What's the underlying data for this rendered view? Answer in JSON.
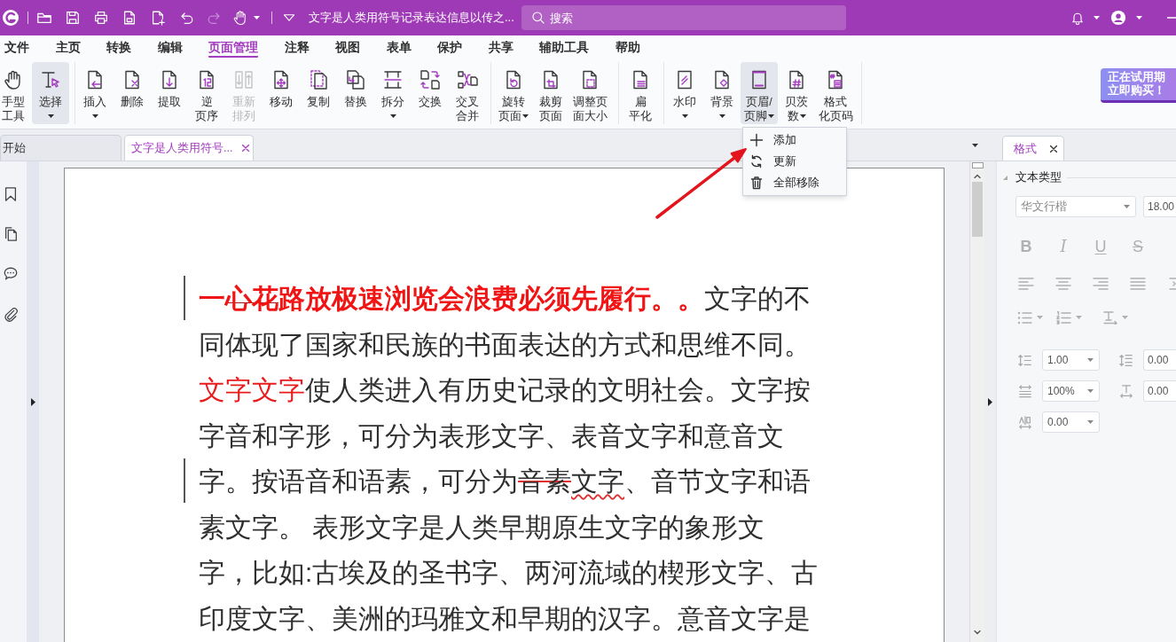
{
  "title_bar": {
    "redo": {
      "disabled": true
    },
    "document_title": "文字是人类用符号记录表达信息以传之...",
    "search": {
      "placeholder": "搜索"
    }
  },
  "menu": [
    {
      "label": "文件",
      "selected": false
    },
    {
      "label": "主页",
      "selected": false
    },
    {
      "label": "转换",
      "selected": false
    },
    {
      "label": "编辑",
      "selected": false
    },
    {
      "label": "页面管理",
      "selected": true
    },
    {
      "label": "注释",
      "selected": false
    },
    {
      "label": "视图",
      "selected": false
    },
    {
      "label": "表单",
      "selected": false
    },
    {
      "label": "保护",
      "selected": false
    },
    {
      "label": "共享",
      "selected": false
    },
    {
      "label": "辅助工具",
      "selected": false
    },
    {
      "label": "帮助",
      "selected": false
    }
  ],
  "ribbon": {
    "groups": [
      [
        {
          "kind": "hand",
          "lines": [
            "手型",
            "工具"
          ],
          "dropdown": false,
          "active": false,
          "disabled": false
        },
        {
          "kind": "select",
          "lines": [
            "选择"
          ],
          "dropdown": true,
          "active": true,
          "disabled": false
        }
      ],
      [
        {
          "kind": "insert",
          "lines": [
            "插入"
          ],
          "dropdown": true,
          "active": false,
          "disabled": false
        },
        {
          "kind": "delete",
          "lines": [
            "删除"
          ],
          "dropdown": false,
          "active": false,
          "disabled": false
        },
        {
          "kind": "extract",
          "lines": [
            "提取"
          ],
          "dropdown": false,
          "active": false,
          "disabled": false
        },
        {
          "kind": "reverse",
          "lines": [
            "逆",
            "页序"
          ],
          "dropdown": false,
          "active": false,
          "disabled": false
        },
        {
          "kind": "reorder",
          "lines": [
            "重新",
            "排列"
          ],
          "dropdown": false,
          "active": false,
          "disabled": true
        },
        {
          "kind": "move",
          "lines": [
            "移动"
          ],
          "dropdown": false,
          "active": false,
          "disabled": false
        },
        {
          "kind": "copy",
          "lines": [
            "复制"
          ],
          "dropdown": false,
          "active": false,
          "disabled": false
        },
        {
          "kind": "replace",
          "lines": [
            "替换"
          ],
          "dropdown": false,
          "active": false,
          "disabled": false
        },
        {
          "kind": "split",
          "lines": [
            "拆分"
          ],
          "dropdown": true,
          "active": false,
          "disabled": false
        },
        {
          "kind": "swap",
          "lines": [
            "交换"
          ],
          "dropdown": false,
          "active": false,
          "disabled": false
        },
        {
          "kind": "merge",
          "lines": [
            "交叉",
            "合并"
          ],
          "dropdown": false,
          "active": false,
          "disabled": false
        }
      ],
      [
        {
          "kind": "rotate",
          "lines": [
            "旋转",
            "页面"
          ],
          "dropdown": true,
          "active": false,
          "disabled": false
        },
        {
          "kind": "crop",
          "lines": [
            "裁剪",
            "页面"
          ],
          "dropdown": false,
          "active": false,
          "disabled": false
        },
        {
          "kind": "resize",
          "lines": [
            "调整页",
            "面大小"
          ],
          "dropdown": false,
          "active": false,
          "disabled": false
        }
      ],
      [
        {
          "kind": "flatten",
          "lines": [
            "扁",
            "平化"
          ],
          "dropdown": false,
          "active": false,
          "disabled": false
        }
      ],
      [
        {
          "kind": "watermark",
          "lines": [
            "水印"
          ],
          "dropdown": true,
          "active": false,
          "disabled": false
        },
        {
          "kind": "background",
          "lines": [
            "背景"
          ],
          "dropdown": true,
          "active": false,
          "disabled": false
        },
        {
          "kind": "headerfooter",
          "lines": [
            "页眉/",
            "页脚"
          ],
          "dropdown": true,
          "active": true,
          "disabled": false
        },
        {
          "kind": "bates",
          "lines": [
            "贝茨",
            "数"
          ],
          "dropdown": true,
          "active": false,
          "disabled": false
        },
        {
          "kind": "pagenumber",
          "lines": [
            "格式",
            "化页码"
          ],
          "dropdown": false,
          "active": false,
          "disabled": false
        }
      ]
    ]
  },
  "promo": {
    "lines": [
      "正在试用期",
      "立即购买！"
    ]
  },
  "header_footer_menu": [
    {
      "kind": "add",
      "label": "添加"
    },
    {
      "kind": "update",
      "label": "更新"
    },
    {
      "kind": "remove",
      "label": "全部移除"
    }
  ],
  "doc_tabs": [
    {
      "label": "开始",
      "selected": false,
      "closable": false
    },
    {
      "label": "文字是人类用符号...",
      "selected": true,
      "closable": true
    }
  ],
  "document": {
    "lines": [
      {
        "changed": true,
        "runs": [
          {
            "kind": "script",
            "text": "一"
          },
          {
            "kind": "scriptstruck",
            "text": "心花"
          },
          {
            "kind": "script",
            "text": "路放极速浏览会浪费必须先履行。。"
          },
          {
            "kind": "plain",
            "text": "文字的不"
          }
        ]
      },
      {
        "changed": false,
        "runs": [
          {
            "kind": "plain",
            "text": "同体现了国家和民族的书面表达的方式和思维不同。"
          }
        ]
      },
      {
        "changed": false,
        "runs": [
          {
            "kind": "red",
            "text": "文字文字"
          },
          {
            "kind": "plain",
            "text": "使人类进入有历史记录的文明社会。文字按"
          }
        ]
      },
      {
        "changed": false,
        "runs": [
          {
            "kind": "plain",
            "text": "字音和字形，可分为表形文字、表音文字和意音文"
          }
        ]
      },
      {
        "changed": true,
        "runs": [
          {
            "kind": "plain",
            "text": "字。按语音和语素，可分为"
          },
          {
            "kind": "struck",
            "text": "音素"
          },
          {
            "kind": "wavy",
            "text": "文字"
          },
          {
            "kind": "plain",
            "text": "、音节文字和语"
          }
        ]
      },
      {
        "changed": false,
        "runs": [
          {
            "kind": "plain",
            "text": "素文字。 表形文字是人类早期原生文字的象形文"
          }
        ]
      },
      {
        "changed": false,
        "runs": [
          {
            "kind": "plain",
            "text": "字，比如:古埃及的圣书字、两河流域的楔形文字、古"
          }
        ]
      },
      {
        "changed": false,
        "runs": [
          {
            "kind": "plain",
            "text": "印度文字、美洲的玛雅文和早期的汉字。意音文字是"
          }
        ]
      }
    ]
  },
  "format_panel": {
    "tab": {
      "label": "格式",
      "selected": true
    },
    "section": {
      "label": "文本类型",
      "expanded": true
    },
    "font": "华文行楷",
    "size": "18.00",
    "disabled": true,
    "style_buttons": [
      {
        "kind": "bold",
        "label": "B"
      },
      {
        "kind": "italic",
        "label": "I"
      },
      {
        "kind": "underline",
        "label": "U"
      },
      {
        "kind": "strike",
        "label": "S"
      }
    ],
    "spacing": [
      {
        "kind": "line",
        "value": "1.00"
      },
      {
        "kind": "paragraph",
        "value": "0.00"
      },
      {
        "kind": "scale",
        "value": "100%"
      },
      {
        "kind": "offset",
        "value": "0.00"
      },
      {
        "kind": "character",
        "value": "0.00"
      }
    ]
  }
}
